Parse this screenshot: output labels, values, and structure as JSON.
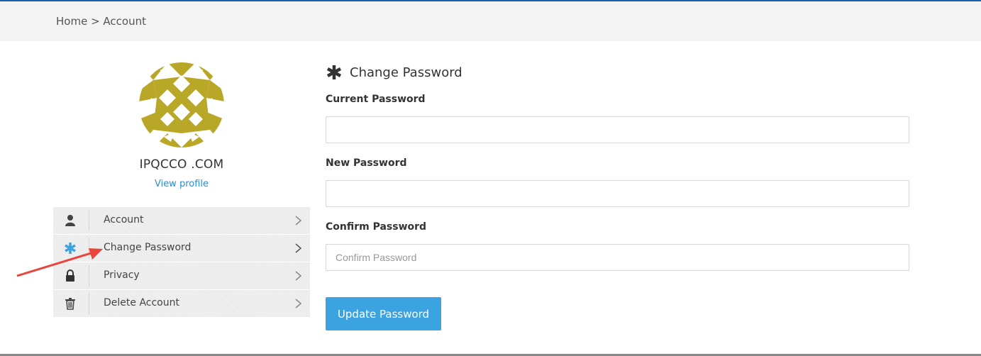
{
  "breadcrumb": {
    "text": "Home > Account"
  },
  "profile": {
    "name": "IPQCCO .COM",
    "view_profile": "View profile"
  },
  "menu": {
    "items": [
      {
        "label": "Account",
        "icon": "user-icon"
      },
      {
        "label": "Change Password",
        "icon": "asterisk-icon",
        "active": true
      },
      {
        "label": "Privacy",
        "icon": "lock-icon"
      },
      {
        "label": "Delete Account",
        "icon": "trash-icon"
      }
    ]
  },
  "form": {
    "title": "Change Password",
    "current_label": "Current Password",
    "current_value": "",
    "new_label": "New Password",
    "new_value": "",
    "confirm_label": "Confirm Password",
    "confirm_placeholder": "Confirm Password",
    "submit_label": "Update Password"
  },
  "colors": {
    "accent": "#3aa3e0",
    "link": "#2e8ccf",
    "avatar": "#b9a827",
    "annotation_arrow": "#e8453c"
  }
}
